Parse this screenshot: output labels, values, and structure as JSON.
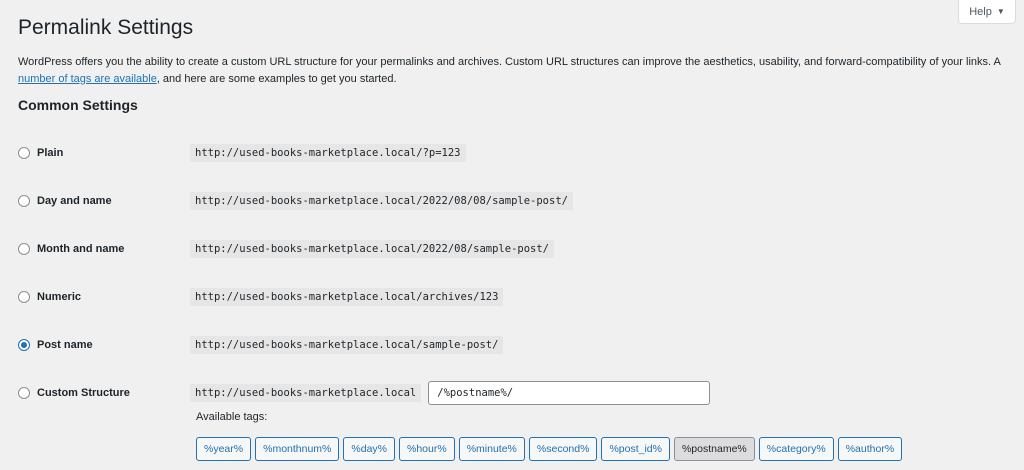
{
  "help_tab": {
    "label": "Help"
  },
  "page": {
    "title": "Permalink Settings",
    "intro_before": "WordPress offers you the ability to create a custom URL structure for your permalinks and archives. Custom URL structures can improve the aesthetics, usability, and forward-compatibility of your links. A ",
    "intro_link": "number of tags are available",
    "intro_after": ", and here are some examples to get you started."
  },
  "common": {
    "title": "Common Settings",
    "options": [
      {
        "label": "Plain",
        "example": "http://used-books-marketplace.local/?p=123",
        "checked": false
      },
      {
        "label": "Day and name",
        "example": "http://used-books-marketplace.local/2022/08/08/sample-post/",
        "checked": false
      },
      {
        "label": "Month and name",
        "example": "http://used-books-marketplace.local/2022/08/sample-post/",
        "checked": false
      },
      {
        "label": "Numeric",
        "example": "http://used-books-marketplace.local/archives/123",
        "checked": false
      },
      {
        "label": "Post name",
        "example": "http://used-books-marketplace.local/sample-post/",
        "checked": true
      },
      {
        "label": "Custom Structure",
        "example": "http://used-books-marketplace.local",
        "checked": false
      }
    ],
    "custom_value": "/%postname%/",
    "available_tags_label": "Available tags:",
    "tags": [
      {
        "label": "%year%",
        "active": false
      },
      {
        "label": "%monthnum%",
        "active": false
      },
      {
        "label": "%day%",
        "active": false
      },
      {
        "label": "%hour%",
        "active": false
      },
      {
        "label": "%minute%",
        "active": false
      },
      {
        "label": "%second%",
        "active": false
      },
      {
        "label": "%post_id%",
        "active": false
      },
      {
        "label": "%postname%",
        "active": true
      },
      {
        "label": "%category%",
        "active": false
      },
      {
        "label": "%author%",
        "active": false
      }
    ]
  },
  "colors": {
    "accent": "#2271b1",
    "background": "#f0f0f1",
    "code_bg": "#e6e6e7",
    "text": "#1d2327"
  },
  "icons": {
    "help_caret": "caret-down-icon"
  }
}
